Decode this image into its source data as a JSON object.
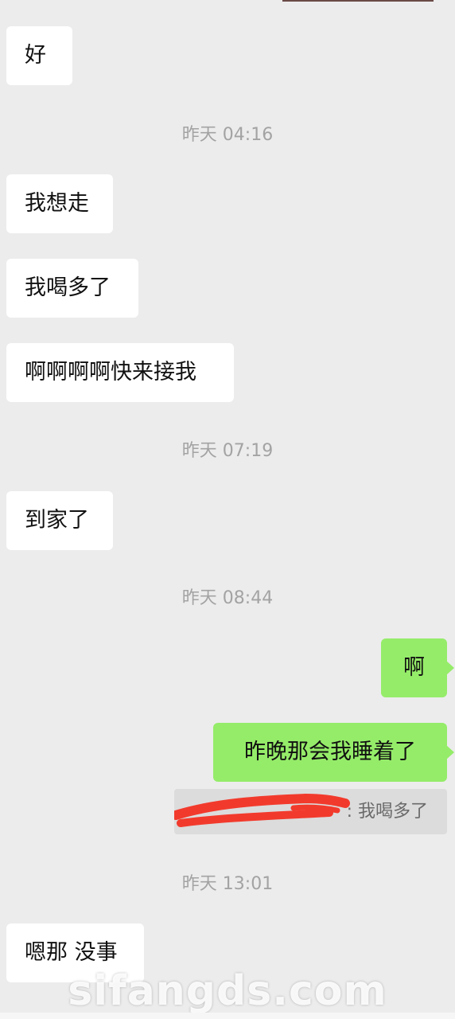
{
  "messages": [
    {
      "type": "incoming",
      "text": "好"
    },
    {
      "type": "timestamp",
      "text": "昨天 04:16"
    },
    {
      "type": "incoming",
      "text": "我想走"
    },
    {
      "type": "incoming",
      "text": "我喝多了"
    },
    {
      "type": "incoming",
      "text": "啊啊啊啊快来接我"
    },
    {
      "type": "timestamp",
      "text": "昨天 07:19"
    },
    {
      "type": "incoming",
      "text": "到家了"
    },
    {
      "type": "timestamp",
      "text": "昨天 08:44"
    },
    {
      "type": "outgoing",
      "text": "啊"
    },
    {
      "type": "outgoing",
      "text": "昨晚那会我睡着了"
    },
    {
      "type": "quote",
      "text": ": 我喝多了",
      "redacted": true
    },
    {
      "type": "timestamp",
      "text": "昨天 13:01"
    },
    {
      "type": "incoming",
      "text": "嗯那 没事"
    }
  ],
  "watermark": "sifangds.com",
  "colors": {
    "background": "#ececec",
    "incoming_bubble": "#ffffff",
    "outgoing_bubble": "#95ec69",
    "timestamp_text": "#a3a3a3",
    "quote_background": "#dcdcdc",
    "redaction": "#f23a2c"
  }
}
